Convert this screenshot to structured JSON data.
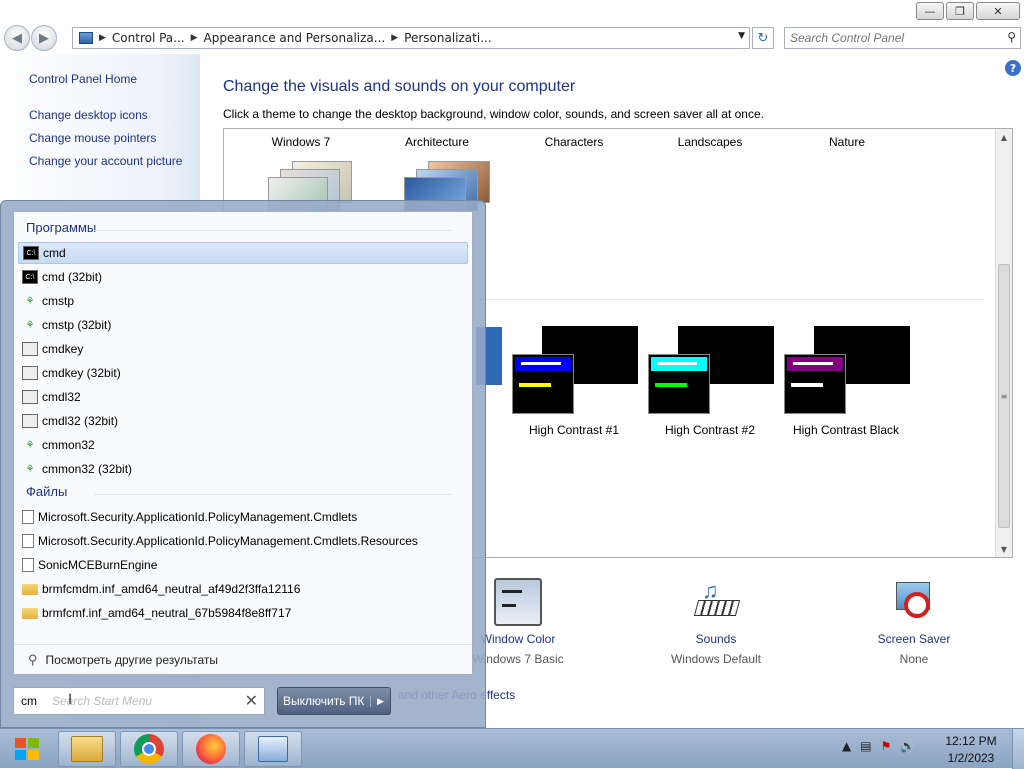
{
  "window": {
    "breadcrumb": [
      "Control Pa...",
      "Appearance and Personaliza...",
      "Personalizati..."
    ],
    "search_placeholder": "Search Control Panel"
  },
  "left_pane": {
    "home": "Control Panel Home",
    "links": [
      "Change desktop icons",
      "Change mouse pointers",
      "Change your account picture"
    ]
  },
  "main": {
    "title": "Change the visuals and sounds on your computer",
    "subtitle": "Click a theme to change the desktop background, window color, sounds, and screen saver all at once.",
    "theme_names": [
      "Windows 7",
      "Architecture",
      "Characters",
      "Landscapes",
      "Nature"
    ],
    "high_contrast": [
      {
        "label": "High Contrast #1",
        "accent": "#0000ff",
        "bar": "#ffff00"
      },
      {
        "label": "High Contrast #2",
        "accent": "#00ffff",
        "bar": "#00ff00"
      },
      {
        "label": "High Contrast Black",
        "accent": "#800080",
        "bar": "#ffffff"
      }
    ],
    "bottom": {
      "window_color": {
        "label": "Window Color",
        "value": "Windows 7 Basic"
      },
      "sounds": {
        "label": "Sounds",
        "value": "Windows Default"
      },
      "screen_saver": {
        "label": "Screen Saver",
        "value": "None"
      }
    },
    "aero_link": "and other Aero effects"
  },
  "start_menu": {
    "programs_header": "Программы",
    "programs": [
      {
        "label": "cmd",
        "icon": "cmd-icon"
      },
      {
        "label": "cmd (32bit)",
        "icon": "cmd-icon"
      },
      {
        "label": "cmstp",
        "icon": "gear-icon"
      },
      {
        "label": "cmstp (32bit)",
        "icon": "gear-icon"
      },
      {
        "label": "cmdkey",
        "icon": "window-icon"
      },
      {
        "label": "cmdkey (32bit)",
        "icon": "window-icon"
      },
      {
        "label": "cmdl32",
        "icon": "app-icon"
      },
      {
        "label": "cmdl32 (32bit)",
        "icon": "app-icon"
      },
      {
        "label": "cmmon32",
        "icon": "gear-icon"
      },
      {
        "label": "cmmon32 (32bit)",
        "icon": "gear-icon"
      }
    ],
    "files_header": "Файлы",
    "files": [
      {
        "label": "Microsoft.Security.ApplicationId.PolicyManagement.Cmdlets",
        "icon": "document-icon"
      },
      {
        "label": "Microsoft.Security.ApplicationId.PolicyManagement.Cmdlets.Resources",
        "icon": "document-icon"
      },
      {
        "label": "SonicMCEBurnEngine",
        "icon": "document-icon"
      },
      {
        "label": "brmfcmdm.inf_amd64_neutral_af49d2f3ffa12116",
        "icon": "folder-icon"
      },
      {
        "label": "brmfcmf.inf_amd64_neutral_67b5984f8e8ff717",
        "icon": "folder-icon"
      }
    ],
    "more_results": "Посмотреть другие результаты",
    "search_value": "cm",
    "search_placeholder": "Search Start Menu",
    "shutdown_label": "Выключить ПК"
  },
  "taskbar": {
    "apps": [
      "file-explorer-icon",
      "chrome-icon",
      "firefox-icon",
      "control-panel-icon"
    ],
    "time": "12:12 PM",
    "date": "1/2/2023"
  },
  "colors": {
    "link": "#1e3287",
    "taskbar": "#8aa4c4",
    "start_menu": "#96aac6"
  }
}
